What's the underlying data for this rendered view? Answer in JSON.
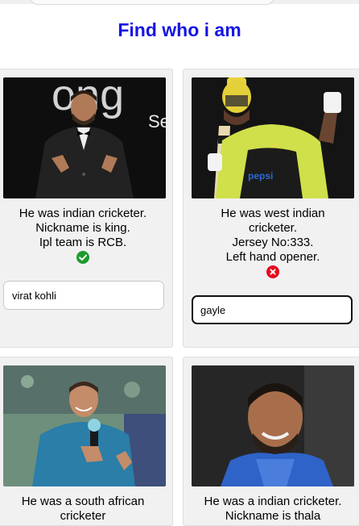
{
  "page": {
    "title": "Find who i am"
  },
  "cards": [
    {
      "clue_lines": [
        "He was indian cricketer.",
        "Nickname is king.",
        "Ipl team is RCB."
      ],
      "answer": "virat kohli",
      "status": "correct"
    },
    {
      "clue_lines": [
        "He was west indian",
        "cricketer.",
        "Jersey No:333.",
        "Left hand opener."
      ],
      "answer": "gayle",
      "status": "wrong"
    },
    {
      "clue_lines": [
        "He was a south african",
        "cricketer"
      ],
      "answer": "",
      "status": "none"
    },
    {
      "clue_lines": [
        "He was a indian cricketer.",
        "Nickname is thala"
      ],
      "answer": "",
      "status": "none"
    }
  ],
  "colors": {
    "title": "#1515e3",
    "correct": "#1d9b2f",
    "wrong": "#e60a1f"
  },
  "icons": {
    "correct": "check-circle-icon",
    "wrong": "x-circle-icon"
  }
}
